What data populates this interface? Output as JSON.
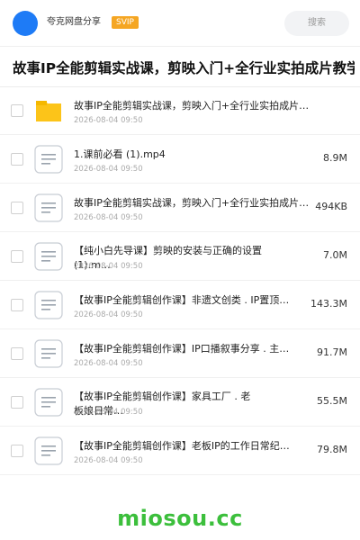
{
  "header": {
    "share_name": "夸克网盘分享",
    "badge": "SVIP",
    "search_placeholder": "搜索"
  },
  "title": "故事IP全能剪辑实战课，剪映入门+全行业实拍成片教学",
  "files": [
    {
      "type": "folder",
      "name": "故事IP全能剪辑实战课，剪映入门+全行业实拍成片教学",
      "date": "2026-08-04 09:50",
      "size": ""
    },
    {
      "type": "file",
      "name": "1.课前必看 (1).mp4",
      "date": "2026-08-04 09:50",
      "size": "8.9M"
    },
    {
      "type": "file",
      "name": "故事IP全能剪辑实战课，剪映入门+全行业实拍成片教…",
      "date": "2026-08-04 09:50",
      "size": "494KB"
    },
    {
      "type": "file",
      "name": "【纯小白先导课】剪映的安装与正确的设置 (1).m…",
      "date": "2026-08-04 09:50",
      "size": "7.0M"
    },
    {
      "type": "file",
      "name": "【故事IP全能剪辑创作课】非遗文创类 . IP置顶…",
      "date": "2026-08-04 09:50",
      "size": "143.3M"
    },
    {
      "type": "file",
      "name": "【故事IP全能剪辑创作课】IP口播叙事分享 . 主…",
      "date": "2026-08-04 09:50",
      "size": "91.7M"
    },
    {
      "type": "file",
      "name": "【故事IP全能剪辑创作课】家具工厂 . 老板娘日常…",
      "date": "2026-08-04 09:50",
      "size": "55.5M"
    },
    {
      "type": "file",
      "name": "【故事IP全能剪辑创作课】老板IP的工作日常纪录…",
      "date": "2026-08-04 09:50",
      "size": "79.8M"
    }
  ],
  "watermark": "miosou.cc",
  "colors": {
    "avatar": "#1e7bf6",
    "badge": "#f5a623",
    "folder": "#fcc419",
    "watermark": "#3cbf3c"
  }
}
